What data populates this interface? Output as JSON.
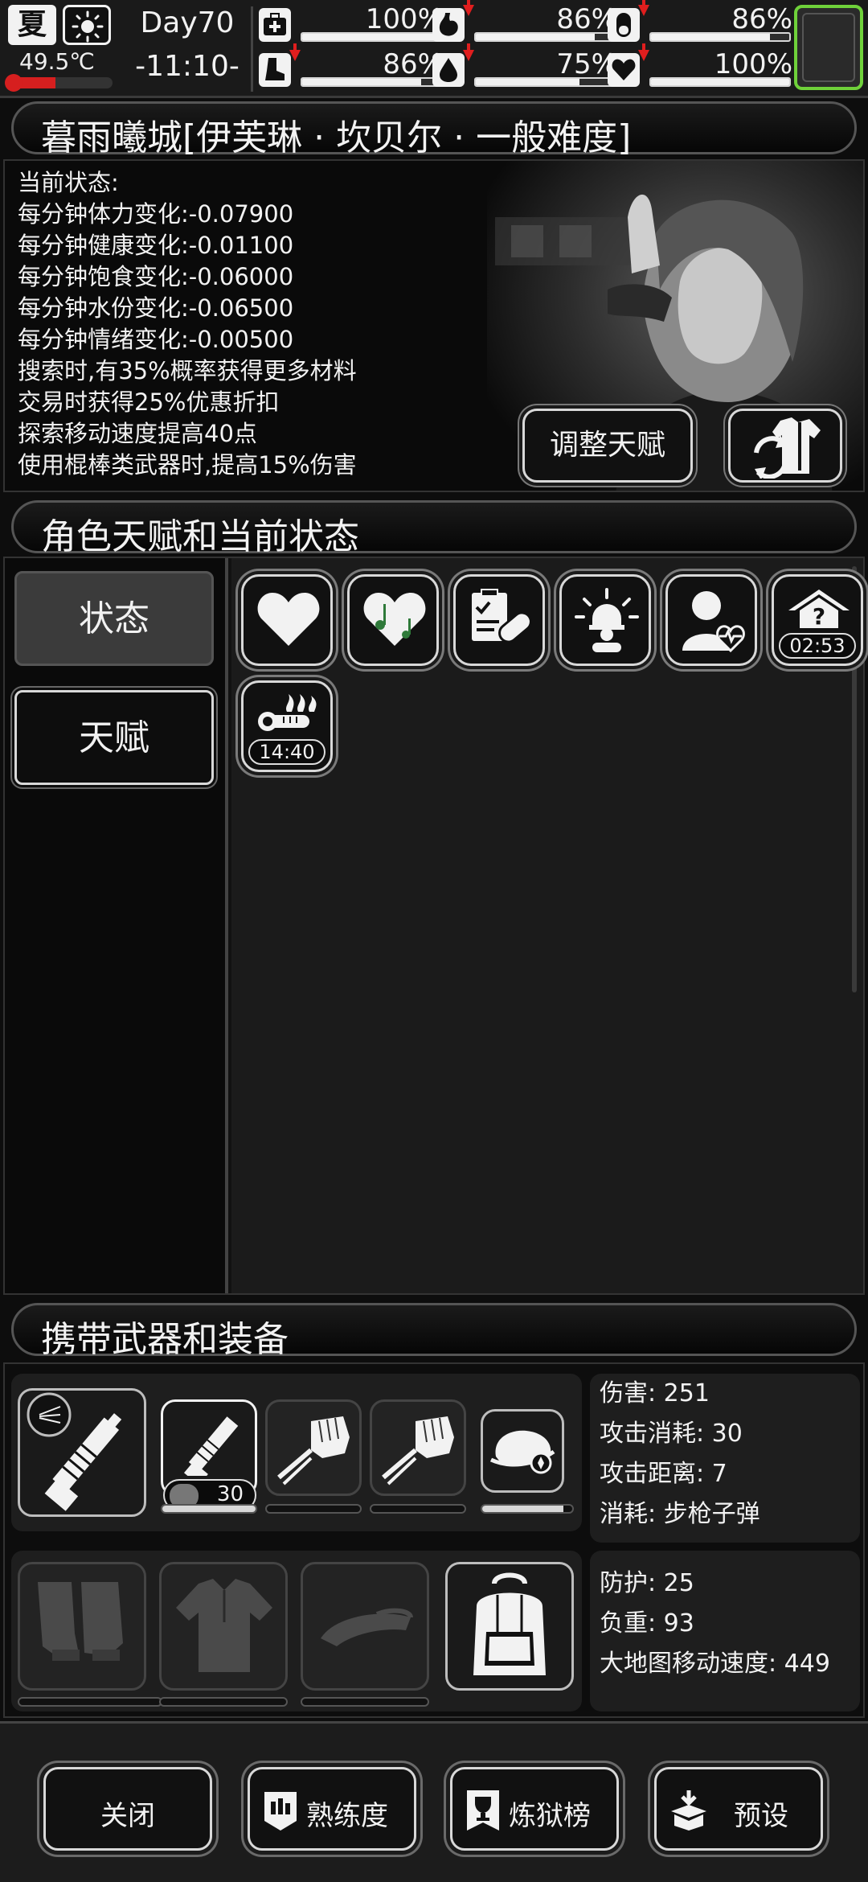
{
  "hud": {
    "season": "夏",
    "temperature": "49.5℃",
    "temperature_level": 0.45,
    "day": "Day70",
    "clock": "-11:10-",
    "stats": [
      {
        "name": "health",
        "icon": "medkit-icon",
        "value": "100%",
        "level": 1.0,
        "declining": false
      },
      {
        "name": "hunger",
        "icon": "stomach-icon",
        "value": "86%",
        "level": 0.86,
        "declining": true
      },
      {
        "name": "medicine",
        "icon": "pill-icon",
        "value": "86%",
        "level": 0.86,
        "declining": true
      },
      {
        "name": "stamina",
        "icon": "boot-icon",
        "value": "86%",
        "level": 0.86,
        "declining": true
      },
      {
        "name": "water",
        "icon": "water-drop-icon",
        "value": "75%",
        "level": 0.75,
        "declining": true
      },
      {
        "name": "mood",
        "icon": "heart-icon",
        "value": "100%",
        "level": 1.0,
        "declining": true
      }
    ]
  },
  "title": "暮雨曦城[伊芙琳 · 坎贝尔 · 一般难度]",
  "status": {
    "lines": [
      "当前状态:",
      "每分钟体力变化:-0.07900",
      "每分钟健康变化:-0.01100",
      "每分钟饱食变化:-0.06000",
      "每分钟水份变化:-0.06500",
      "每分钟情绪变化:-0.00500",
      "搜索时,有35%概率获得更多材料",
      "交易时获得25%优惠折扣",
      "探索移动速度提高40点",
      "使用棍棒类武器时,提高15%伤害"
    ],
    "adjust_talent_button": "调整天赋"
  },
  "talent_section": {
    "header": "角色天赋和当前状态",
    "tab_status": "状态",
    "tab_talent": "天赋",
    "icons": [
      {
        "name": "heart-status-icon",
        "timer": ""
      },
      {
        "name": "music-heart-icon",
        "timer": ""
      },
      {
        "name": "clipboard-bandage-icon",
        "timer": ""
      },
      {
        "name": "alarm-person-icon",
        "timer": ""
      },
      {
        "name": "person-heartbeat-icon",
        "timer": ""
      },
      {
        "name": "unknown-house-icon",
        "timer": "02:53"
      },
      {
        "name": "hot-thermometer-icon",
        "timer": "14:40"
      }
    ]
  },
  "equipment": {
    "header": "携带武器和装备",
    "ammo_count": "30",
    "weapon_durability": [
      0,
      1.0,
      0,
      0,
      0.9
    ],
    "weapon_stats": [
      "伤害: 251",
      "攻击消耗: 30",
      "攻击距离: 7",
      "消耗: 步枪子弹"
    ],
    "gear_stats": [
      "防护: 25",
      "负重: 93",
      "大地图移动速度: 449"
    ]
  },
  "bottom_buttons": {
    "close": "关闭",
    "proficiency": "熟练度",
    "ranking": "炼狱榜",
    "preset": "预设"
  },
  "colors": {
    "background": "#0d0d0d",
    "text": "#f2f2f2",
    "alert_red": "#e01e1e",
    "accent_green": "#6fd13a"
  }
}
